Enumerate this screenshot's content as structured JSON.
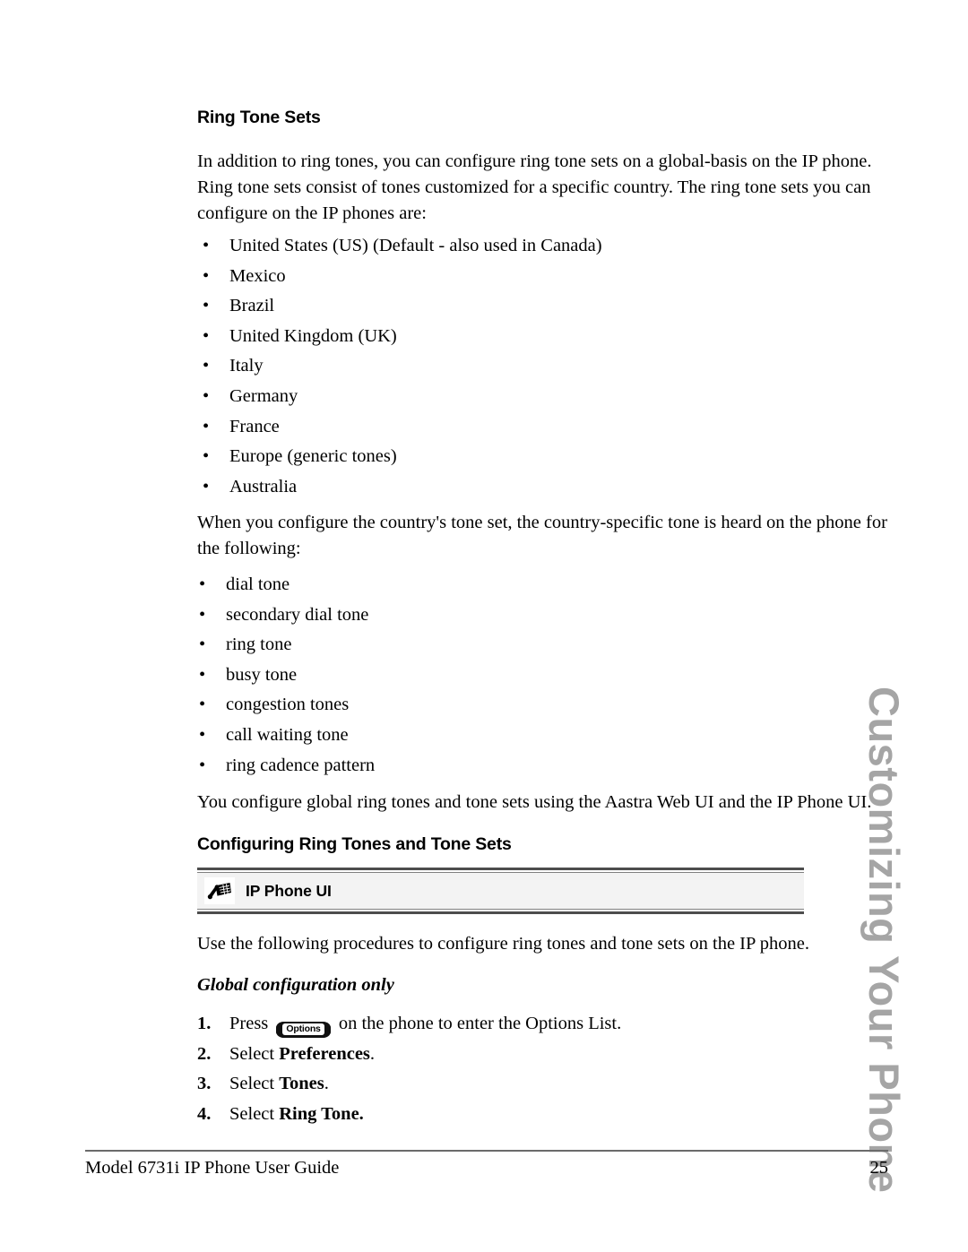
{
  "document": {
    "section_heading": "Ring Tone Sets",
    "intro_paragraph": "In addition to ring tones, you can configure ring tone sets on a global-basis on the IP phone. Ring tone sets consist of tones customized for a specific country. The ring tone sets you can configure on the IP phones are:",
    "country_list": [
      "United States (US) (Default - also used in Canada)",
      "Mexico",
      "Brazil",
      "United Kingdom (UK)",
      "Italy",
      "Germany",
      "France",
      "Europe (generic tones)",
      "Australia"
    ],
    "tone_paragraph": "When you configure the country's tone set, the country-specific tone is heard on the phone for the following:",
    "tones_list": [
      "dial tone",
      "secondary dial tone",
      "ring tone",
      "busy tone",
      "congestion tones",
      "call waiting tone",
      "ring cadence pattern"
    ],
    "webui_paragraph": "You configure global ring tones and tone sets using the Aastra Web UI and the IP Phone UI.",
    "subsection_heading": "Configuring Ring Tones and Tone Sets",
    "banner": {
      "icon": "desk-phone-icon",
      "label": "IP Phone UI"
    },
    "procedures_paragraph": "Use the following procedures to configure ring tones and tone sets on the IP phone.",
    "global_config_note": "Global configuration only",
    "steps": [
      {
        "number": "1.",
        "prefix": "Press",
        "key_label": "Options",
        "suffix": "on the phone to enter the Options List."
      },
      {
        "number": "2.",
        "prefix": "Select",
        "bold": "Preferences",
        "suffix": "."
      },
      {
        "number": "3.",
        "prefix": "Select",
        "bold": "Tones",
        "suffix": "."
      },
      {
        "number": "4.",
        "prefix": "Select",
        "bold": "Ring Tone.",
        "suffix": ""
      }
    ],
    "side_tab": "Customizing Your Phone",
    "footer": {
      "title": "Model 6731i IP Phone User Guide",
      "page_number": "25"
    }
  },
  "colors": {
    "text": "#000000",
    "banner_background": "#f3f3f3",
    "rule": "#4d4d4d",
    "side_tab": "#a5a5a5",
    "page_background": "#ffffff"
  }
}
